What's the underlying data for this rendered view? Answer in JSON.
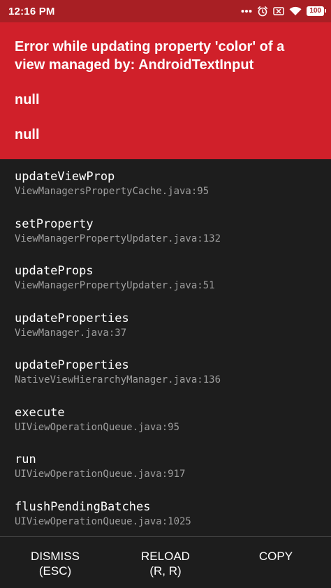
{
  "status_bar": {
    "time": "12:16 PM",
    "icons": [
      "dots-icon",
      "alarm-icon",
      "sim-off-icon",
      "wifi-icon"
    ],
    "battery": "100",
    "background": "#a81f24"
  },
  "error": {
    "title": "Error while updating property 'color' of a view managed by: AndroidTextInput",
    "details": [
      "null",
      "null"
    ],
    "background": "#d0202a"
  },
  "stack": [
    {
      "method": "updateViewProp",
      "file": "ViewManagersPropertyCache.java:95"
    },
    {
      "method": "setProperty",
      "file": "ViewManagerPropertyUpdater.java:132"
    },
    {
      "method": "updateProps",
      "file": "ViewManagerPropertyUpdater.java:51"
    },
    {
      "method": "updateProperties",
      "file": "ViewManager.java:37"
    },
    {
      "method": "updateProperties",
      "file": "NativeViewHierarchyManager.java:136"
    },
    {
      "method": "execute",
      "file": "UIViewOperationQueue.java:95"
    },
    {
      "method": "run",
      "file": "UIViewOperationQueue.java:917"
    },
    {
      "method": "flushPendingBatches",
      "file": "UIViewOperationQueue.java:1025"
    }
  ],
  "actions": {
    "dismiss": {
      "line1": "DISMISS",
      "line2": "(ESC)"
    },
    "reload": {
      "line1": "RELOAD",
      "line2": "(R, R)"
    },
    "copy": {
      "line1": "COPY",
      "line2": ""
    }
  },
  "colors": {
    "stack_background": "#1d1d1d",
    "file_text": "#9e9e9e"
  }
}
